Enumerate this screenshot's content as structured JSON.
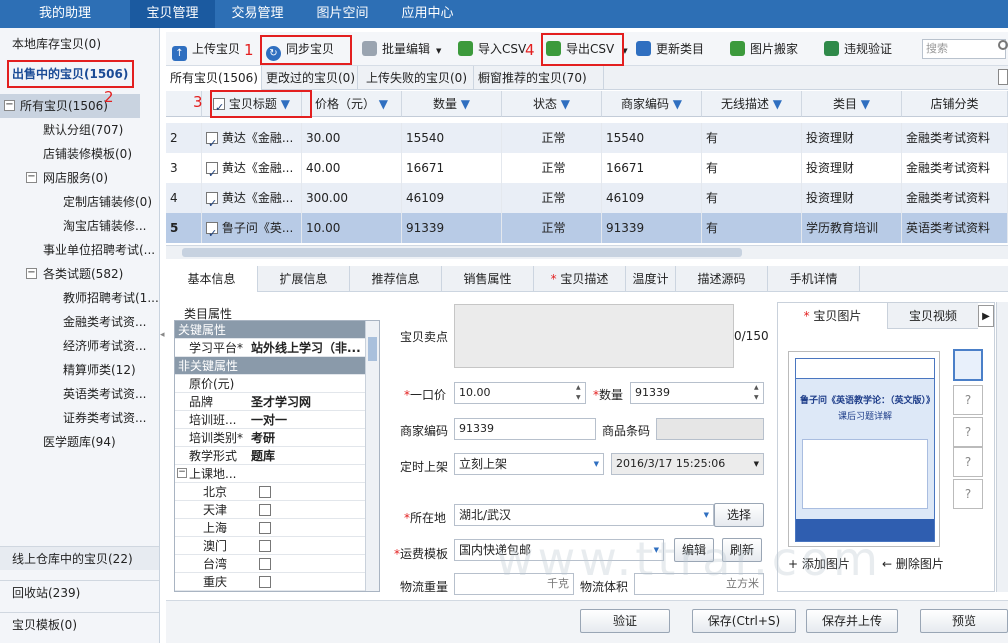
{
  "topnav": {
    "items": [
      "我的助理",
      "宝贝管理",
      "交易管理",
      "图片空间",
      "应用中心"
    ]
  },
  "sidebar": {
    "local": "本地库存宝贝(0)",
    "selling": "出售中的宝贝(1506)",
    "tree": [
      "所有宝贝(1506)",
      "默认分组(707)",
      "店铺装修模板(0)",
      "网店服务(0)",
      "定制店铺装修(0)",
      "淘宝店铺装修...",
      "事业单位招聘考试(...",
      "各类试题(582)",
      "教师招聘考试(1...",
      "金融类考试资...",
      "经济师考试资...",
      "精算师类(12)",
      "英语类考试资...",
      "证券类考试资...",
      "医学题库(94)"
    ],
    "warehouse": "线上仓库中的宝贝(22)",
    "recycle": "回收站(239)",
    "template": "宝贝模板(0)",
    "nums": [
      "1",
      "2",
      "3",
      "4"
    ]
  },
  "toolbar": {
    "upload": "上传宝贝",
    "sync": "同步宝贝",
    "batch": "批量编辑",
    "import": "导入CSV",
    "export": "导出CSV",
    "update_cat": "更新类目",
    "img_move": "图片搬家",
    "validate": "违规验证",
    "search_placeholder": "搜索"
  },
  "filter_tabs": [
    "所有宝贝(1506)",
    "更改过的宝贝(0)",
    "上传失败的宝贝(0)",
    "橱窗推荐的宝贝(70)"
  ],
  "grid": {
    "headers": [
      "宝贝标题",
      "价格（元）",
      "数量",
      "状态",
      "商家编码",
      "无线描述",
      "类目",
      "店铺分类"
    ],
    "rows": [
      {
        "idx": "2",
        "title": "黄达《金融...",
        "price": "30.00",
        "qty": "15540",
        "status": "正常",
        "code": "15540",
        "wireless": "有",
        "cat": "投资理财",
        "shop": "金融类考试资料"
      },
      {
        "idx": "3",
        "title": "黄达《金融...",
        "price": "40.00",
        "qty": "16671",
        "status": "正常",
        "code": "16671",
        "wireless": "有",
        "cat": "投资理财",
        "shop": "金融类考试资料"
      },
      {
        "idx": "4",
        "title": "黄达《金融...",
        "price": "300.00",
        "qty": "46109",
        "status": "正常",
        "code": "46109",
        "wireless": "有",
        "cat": "投资理财",
        "shop": "金融类考试资料"
      },
      {
        "idx": "5",
        "title": "鲁子问《英...",
        "price": "10.00",
        "qty": "91339",
        "status": "正常",
        "code": "91339",
        "wireless": "有",
        "cat": "学历教育培训",
        "shop": "英语类考试资料"
      }
    ]
  },
  "detail_tabs": [
    "基本信息",
    "扩展信息",
    "推荐信息",
    "销售属性",
    "宝贝描述",
    "温度计",
    "描述源码",
    "手机详情"
  ],
  "props": {
    "title": "类目属性",
    "key_header": "关键属性",
    "platform_label": "学习平台*",
    "platform_value": "站外线上学习（非...",
    "nonkey_header": "非关键属性",
    "rows": [
      [
        "原价(元)",
        ""
      ],
      [
        "品牌",
        "圣才学习网"
      ],
      [
        "培训班...",
        "一对一"
      ],
      [
        "培训类别*",
        "考研"
      ],
      [
        "教学形式",
        "题库"
      ]
    ],
    "location_label": "上课地...",
    "cities": [
      "北京",
      "天津",
      "上海",
      "澳门",
      "台湾",
      "重庆"
    ]
  },
  "form": {
    "selling_point": "宝贝卖点",
    "counter": "0/150",
    "price_label": "一口价",
    "price": "10.00",
    "qty_label": "数量",
    "qty": "91339",
    "code_label": "商家编码",
    "code": "91339",
    "barcode_label": "商品条码",
    "timing_label": "定时上架",
    "timing": "立刻上架",
    "timing_date": "2016/3/17 15:25:06",
    "location_label": "所在地",
    "location": "湖北/武汉",
    "choose": "选择",
    "freight_label": "运费模板",
    "freight": "国内快递包邮",
    "edit": "编辑",
    "refresh": "刷新",
    "weight_label": "物流重量",
    "weight_unit": "千克",
    "volume_label": "物流体积",
    "volume_unit": "立方米"
  },
  "media": {
    "img_tab": "宝贝图片",
    "video_tab": "宝贝视频",
    "book_line1": "鲁子问《英语教学论：（英文版）》",
    "book_line2": "课后习题详解",
    "add": "添加图片",
    "del": "删除图片",
    "q": "?"
  },
  "footer": {
    "verify": "验证",
    "save": "保存(Ctrl+S)",
    "save_upload": "保存并上传",
    "preview": "预览"
  },
  "watermark": "www.ttrar.com"
}
